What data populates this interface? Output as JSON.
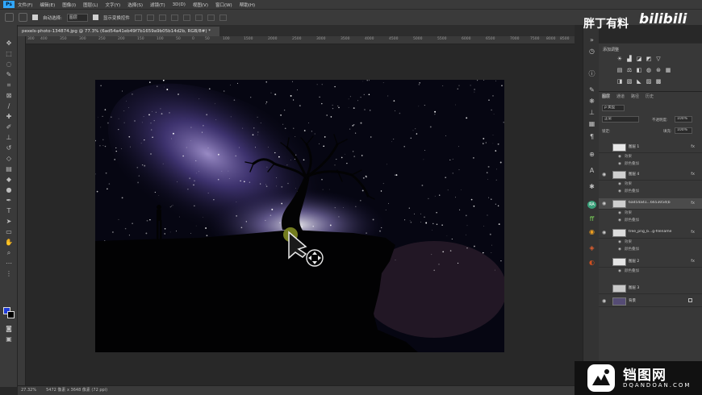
{
  "menu": {
    "items": [
      "文件(F)",
      "编辑(E)",
      "图像(I)",
      "图层(L)",
      "文字(Y)",
      "选择(S)",
      "滤镜(T)",
      "3D(D)",
      "视图(V)",
      "窗口(W)",
      "帮助(H)"
    ]
  },
  "options": {
    "auto_select_label": "自动选择:",
    "auto_select_value": "图层",
    "show_transform_label": "显示变换控件"
  },
  "document": {
    "tab_title": "pexels-photo-134874.jpg @ 77.3% (6ad54a41eb49f7b1659a9b05b14d2b, RGB/8#) *"
  },
  "ruler": {
    "ticks": [
      "300",
      "400",
      "350",
      "300",
      "250",
      "200",
      "150",
      "100",
      "50",
      "0",
      "50",
      "100",
      "1500",
      "2000",
      "2500",
      "3000",
      "3500",
      "4000",
      "4500",
      "5000",
      "5500",
      "6000",
      "6500",
      "7000",
      "7500",
      "8000",
      "8500",
      "9000"
    ]
  },
  "status": {
    "zoom": "27.32%",
    "doc_info": "5472 像素 x 3648 像素 (72 ppi)"
  },
  "adjustments": {
    "title": "添加调整"
  },
  "layers_panel": {
    "tabs": [
      "图层",
      "通道",
      "路径",
      "历史"
    ],
    "filter_value": "ρ 类型",
    "blend_mode": "正常",
    "opacity_label": "不透明度:",
    "opacity_value": "100%",
    "lock_label": "锁定:",
    "fill_label": "填充:",
    "fill_value": "100%",
    "layers": [
      {
        "name": "图层 1",
        "fx": "fx",
        "thumb": "#e8e8e8",
        "effects_label": "效果",
        "effect": "颜色叠加"
      },
      {
        "name": "图层 4",
        "fx": "fx",
        "thumb": "#d0d0d0",
        "effects_label": "效果",
        "effect": "颜色叠加"
      },
      {
        "name": "6ad54a41...6653054(b",
        "fx": "fx",
        "thumb": "#cfcfcf",
        "effects_label": "效果",
        "effect": "颜色叠加"
      },
      {
        "name": "tree_png_b...g-filename",
        "fx": "fx",
        "thumb": "#dcdcdc",
        "effects_label": "效果",
        "effect": "颜色叠加"
      },
      {
        "name": "图层 2",
        "fx": "fx",
        "thumb": "#e4e4e4",
        "effects_label": "",
        "effect": "颜色叠加"
      },
      {
        "name": "图层 3",
        "fx": "",
        "thumb": "#c9c9c9",
        "effects_label": "",
        "effect": ""
      },
      {
        "name": "背景",
        "fx": "",
        "thumb": "#554c75",
        "effects_label": "",
        "effect": ""
      }
    ]
  },
  "watermarks": {
    "top_text": "胖丁有料",
    "top_logo": "bilibili",
    "bottom_title": "铛图网",
    "bottom_sub": "DQANDOAN.COM"
  },
  "colors": {
    "foreground": "#1f3cd8",
    "background": "#000000",
    "ui_panel": "#383838"
  }
}
